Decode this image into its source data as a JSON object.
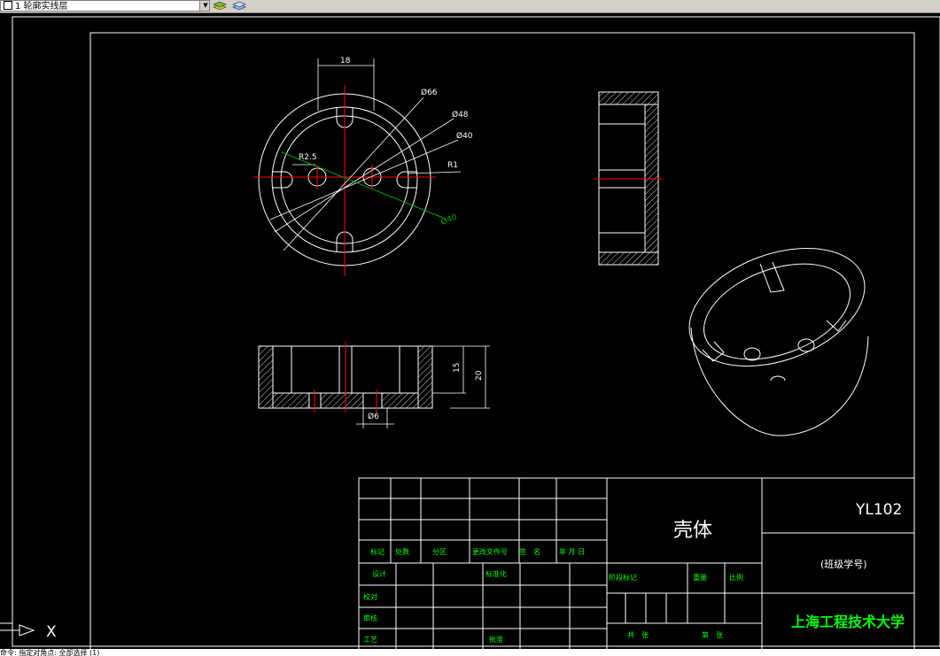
{
  "toolbar": {
    "layer_name": "1 轮廓实线层",
    "icons": [
      "layer-state-icon",
      "layer-previous-icon"
    ]
  },
  "dims": {
    "d18": "18",
    "d66": "Ø66",
    "d48": "Ø48",
    "d40": "Ø40",
    "d40b": "Ø40",
    "r25": "R2.5",
    "r1": "R1",
    "d15": "15",
    "d20": "20",
    "d6": "Ø6"
  },
  "titleblock": {
    "part_name": "壳体",
    "drawing_no": "YL102",
    "class_id": "(班级学号)",
    "school": "上海工程技术大学",
    "row_labels": [
      "标记",
      "处数",
      "分区",
      "更改文件号",
      "签　名",
      "年 月 日"
    ],
    "design": "设计",
    "standardize": "标准化",
    "check": "校对",
    "review": "审核",
    "process": "工艺",
    "approve": "批准",
    "stage_mark": "阶段标记",
    "weight": "重量",
    "scale": "比例",
    "sheets_total": "共　张",
    "sheet_no": "第　张"
  },
  "ucs": {
    "x_label": "X"
  },
  "command_line": {
    "text": "命令: 指定对角点: 全部选择 (1)"
  },
  "colors": {
    "background": "#000000",
    "lines": "#ffffff",
    "centerline": "#ff0000",
    "dimension": "#ffffff",
    "dim_green": "#00aa00",
    "titleblock_text": "#00ff00"
  }
}
